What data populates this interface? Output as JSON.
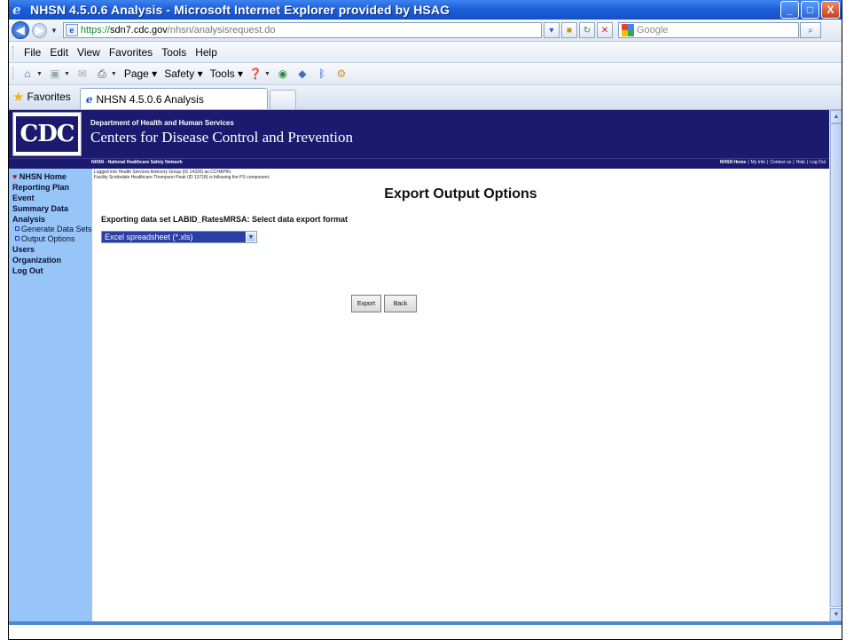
{
  "window": {
    "title": "NHSN 4.5.0.6 Analysis - Microsoft Internet Explorer provided by HSAG",
    "buttons": {
      "minimize": "_",
      "maximize": "□",
      "close": "X"
    }
  },
  "address": {
    "url_scheme": "https://",
    "url_domain": "sdn7.cdc.gov",
    "url_path": "/nhsn/analysisrequest.do",
    "search_placeholder": "Google"
  },
  "menu": [
    "File",
    "Edit",
    "View",
    "Favorites",
    "Tools",
    "Help"
  ],
  "command_bar": {
    "page": "Page",
    "safety": "Safety",
    "tools": "Tools"
  },
  "favorites": {
    "label": "Favorites",
    "tab_title": "NHSN 4.5.0.6 Analysis"
  },
  "header": {
    "logo": "CDC",
    "department": "Department of Health and Human Services",
    "agency": "Centers for Disease Control and Prevention",
    "network": "NHSN - National Healthcare Safety Network",
    "links": [
      "NHSN Home",
      "|",
      "My Info",
      "|",
      "Contact us",
      "|",
      "Help",
      "|",
      "Log Out"
    ]
  },
  "login": {
    "line1": "Logged into Health Services Advisory Group (ID 14330) as CCHAPIN.",
    "line2": "Facility Scottsdale Healthcare Thompson Peak (ID 13718) is following the PS component."
  },
  "sidebar": {
    "items": [
      {
        "label": "NHSN Home"
      },
      {
        "label": "Reporting Plan"
      },
      {
        "label": "Event"
      },
      {
        "label": "Summary Data"
      },
      {
        "label": "Analysis"
      },
      {
        "label": "Generate Data Sets"
      },
      {
        "label": "Output Options"
      },
      {
        "label": "Users"
      },
      {
        "label": "Organization"
      },
      {
        "label": "Log Out"
      }
    ]
  },
  "main": {
    "title": "Export Output Options",
    "prompt": "Exporting data set LABID_RatesMRSA: Select data export format",
    "format_selected": "Excel spreadsheet (*.xls)",
    "export_label": "Export",
    "back_label": "Back"
  },
  "colors": {
    "header_navy": "#1b1a6e",
    "sidebar_blue": "#98c5f8",
    "select_highlight": "#2b3ea5"
  }
}
